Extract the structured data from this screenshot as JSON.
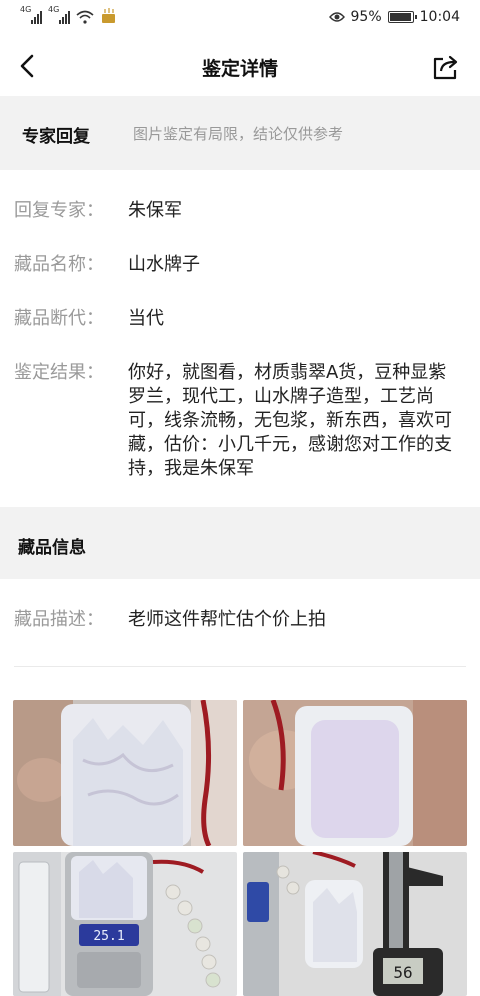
{
  "status_bar": {
    "signal1_label": "4G",
    "signal2_label": "4G",
    "battery_percent": "95%",
    "time": "10:04",
    "battery_level": 0.95
  },
  "nav": {
    "title": "鉴定详情",
    "back_icon": "chevron-left-icon",
    "share_icon": "share-icon"
  },
  "expert_section": {
    "title": "专家回复",
    "note": "图片鉴定有局限，结论仅供参考"
  },
  "details": [
    {
      "label": "回复专家：",
      "value": "朱保军"
    },
    {
      "label": "藏品名称：",
      "value": "山水牌子"
    },
    {
      "label": "藏品断代：",
      "value": "当代"
    },
    {
      "label": "鉴定结果：",
      "value": "你好，就图看，材质翡翠A货，豆种显紫罗兰，现代工，山水牌子造型，工艺尚可，线条流畅，无包浆，新东西，喜欢可藏，估价：小几千元，感谢您对工作的支持，我是朱保军"
    }
  ],
  "item_section": {
    "title": "藏品信息",
    "description_label": "藏品描述：",
    "description_value": "老师这件帮忙估个价上拍"
  },
  "photos": {
    "scale_reading": "25.1",
    "caliper_reading": "56"
  }
}
